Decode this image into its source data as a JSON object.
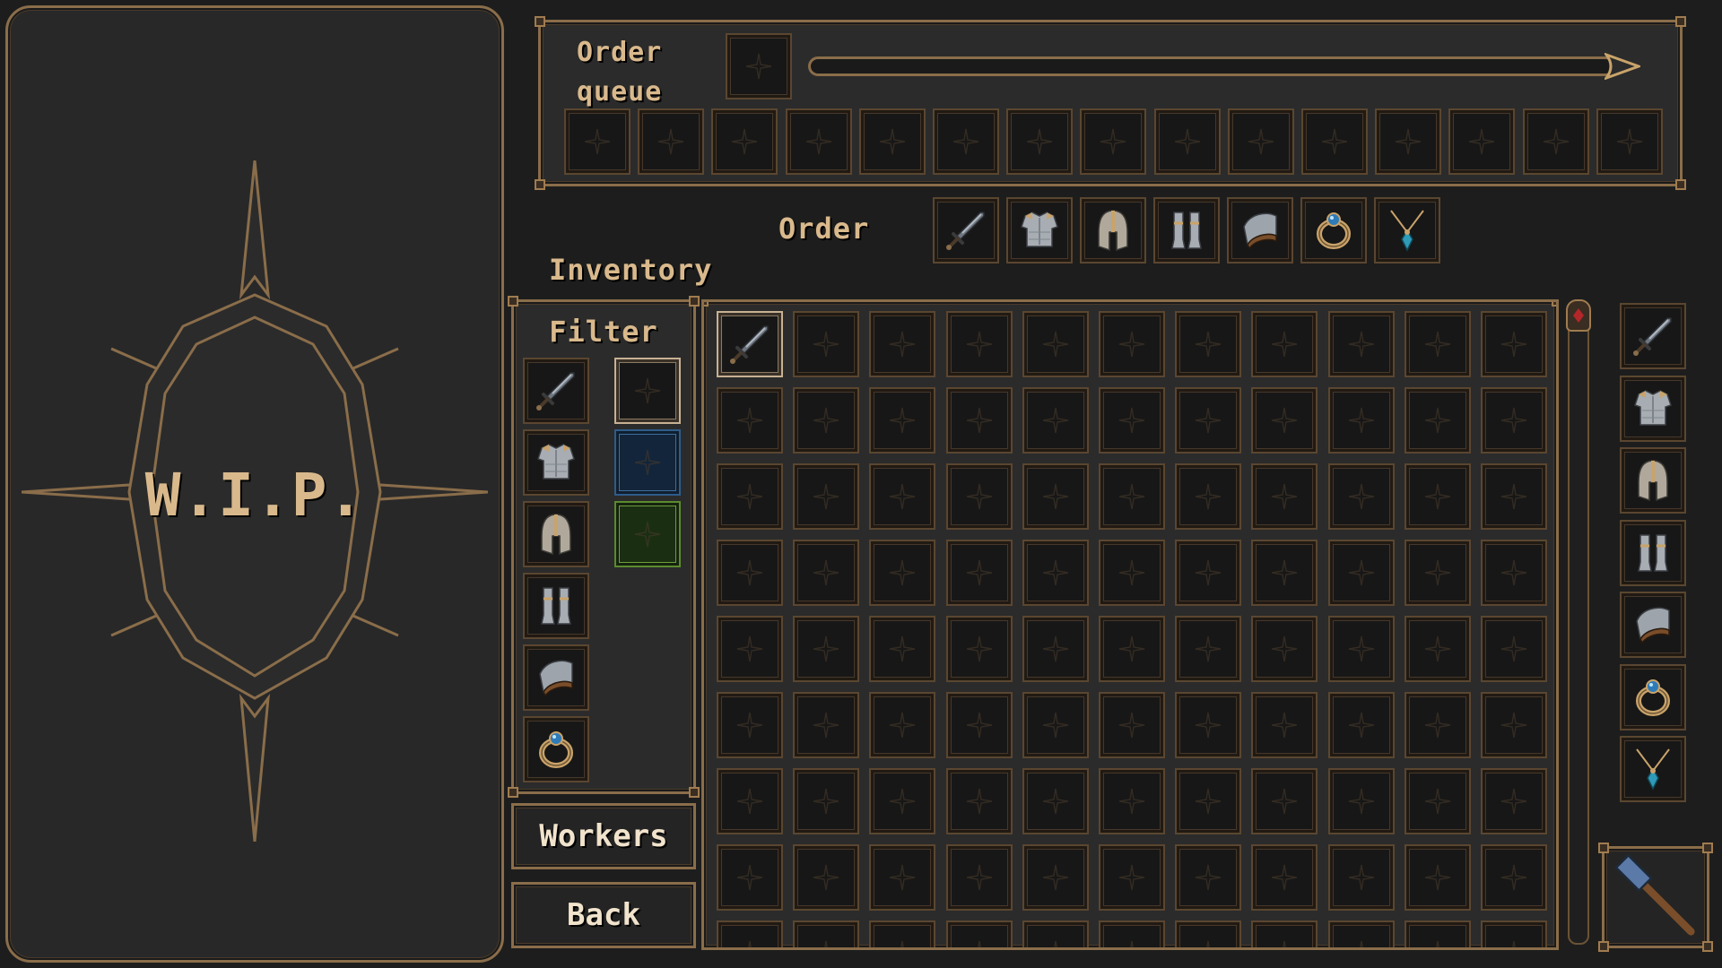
{
  "left_panel": {
    "wip_text": "W.I.P."
  },
  "order_queue": {
    "label_line1": "Order",
    "label_line2": "queue",
    "progress": 0.0,
    "queue_slots": 15
  },
  "order": {
    "label": "Order",
    "items": [
      "sword-icon",
      "chestplate-icon",
      "helmet-icon",
      "greaves-icon",
      "bracer-icon",
      "ring-icon",
      "amulet-icon"
    ]
  },
  "inventory": {
    "label": "Inventory",
    "columns": 11,
    "visible_rows": 8,
    "items": [
      {
        "row": 0,
        "col": 0,
        "icon": "sword-icon",
        "selected": true
      }
    ]
  },
  "filter": {
    "label": "Filter",
    "type_filters": [
      "sword-icon",
      "chestplate-icon",
      "helmet-icon",
      "greaves-icon",
      "bracer-icon",
      "ring-icon"
    ],
    "rarity_filters": [
      "common",
      "rare",
      "uncommon"
    ]
  },
  "right_bar": {
    "items": [
      "sword-icon",
      "chestplate-icon",
      "helmet-icon",
      "greaves-icon",
      "bracer-icon",
      "ring-icon",
      "amulet-icon"
    ],
    "tool": "hammer-icon"
  },
  "buttons": {
    "workers": "Workers",
    "back": "Back"
  },
  "colors": {
    "accent_gold": "#d9b98c",
    "frame_bronze": "#8a6d4a",
    "panel_bg": "#2b2b2b",
    "slot_bg": "#171717"
  }
}
